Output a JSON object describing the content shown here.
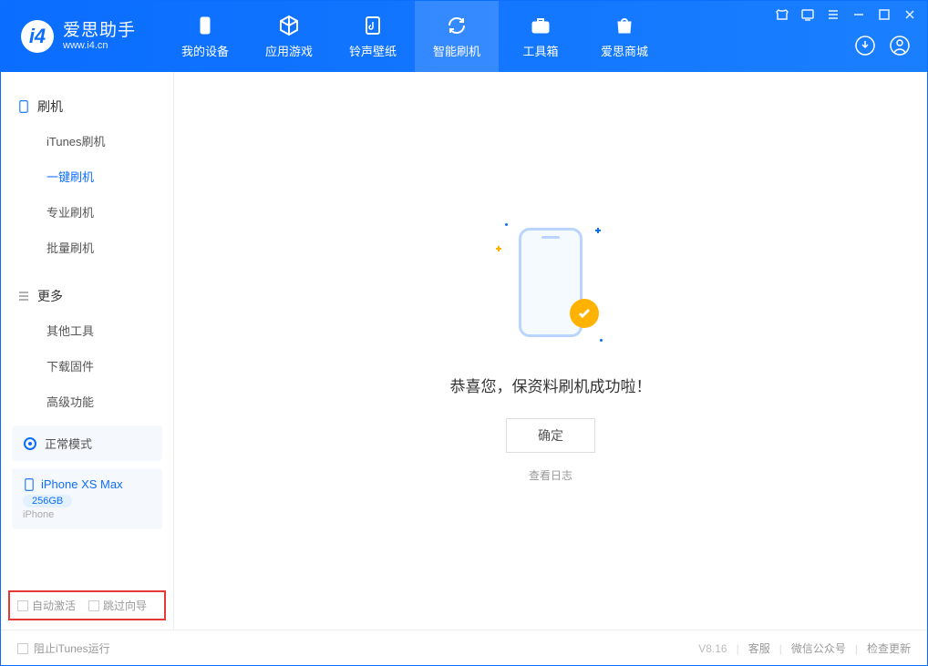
{
  "app": {
    "title": "爱思助手",
    "subtitle": "www.i4.cn"
  },
  "nav": {
    "items": [
      {
        "label": "我的设备"
      },
      {
        "label": "应用游戏"
      },
      {
        "label": "铃声壁纸"
      },
      {
        "label": "智能刷机"
      },
      {
        "label": "工具箱"
      },
      {
        "label": "爱思商城"
      }
    ]
  },
  "sidebar": {
    "section1": {
      "title": "刷机",
      "items": [
        "iTunes刷机",
        "一键刷机",
        "专业刷机",
        "批量刷机"
      ]
    },
    "section2": {
      "title": "更多",
      "items": [
        "其他工具",
        "下载固件",
        "高级功能"
      ]
    },
    "mode": "正常模式",
    "device": {
      "name": "iPhone XS Max",
      "storage": "256GB",
      "type": "iPhone"
    },
    "checkboxes": {
      "cb1": "自动激活",
      "cb2": "跳过向导"
    }
  },
  "main": {
    "success": "恭喜您，保资料刷机成功啦！",
    "ok": "确定",
    "log": "查看日志"
  },
  "footer": {
    "block_itunes": "阻止iTunes运行",
    "version": "V8.16",
    "links": [
      "客服",
      "微信公众号",
      "检查更新"
    ]
  }
}
